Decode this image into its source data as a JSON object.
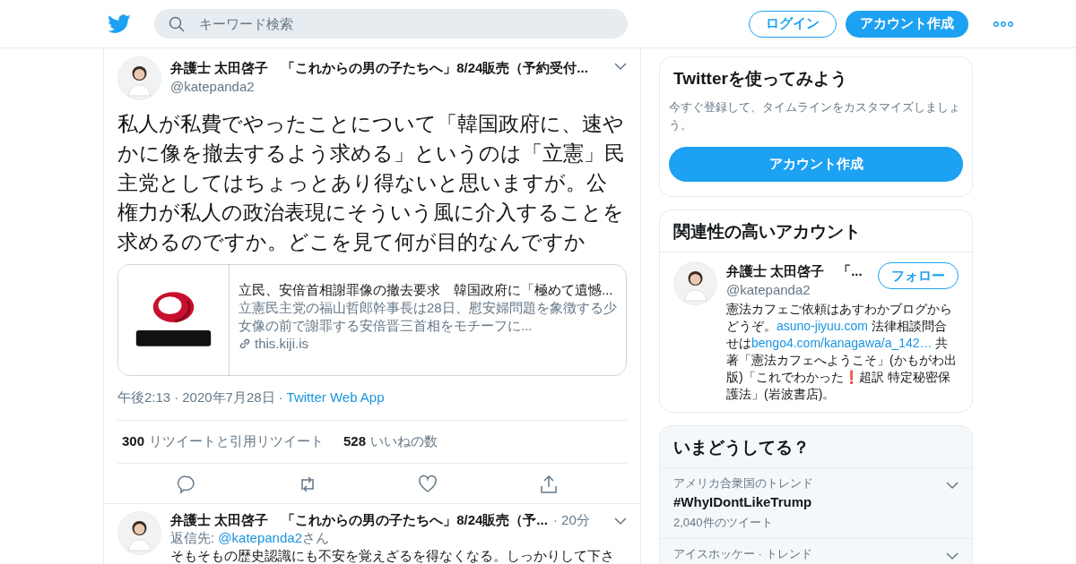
{
  "header": {
    "search": {
      "placeholder": "キーワード検索"
    },
    "login": "ログイン",
    "signup": "アカウント作成"
  },
  "tweet": {
    "name": "弁護士 太田啓子　「これからの男の子たちへ」8/24販売（予約受付...",
    "handle": "@katepanda2",
    "text": "私人が私費でやったことについて「韓国政府に、速やかに像を撤去するよう求める」というのは「立憲」民主党としてはちょっとあり得ないと思いますが。公権力が私人の政治表現にそういう風に介入することを求めるのですか。どこを見て何が目的なんですか",
    "card": {
      "title": "立民、安倍首相謝罪像の撤去要求　韓国政府に「極めて遺憾...",
      "description": "立憲民主党の福山哲郎幹事長は28日、慰安婦問題を象徴する少女像の前で謝罪する安倍晋三首相をモチーフに...",
      "domain": "this.kiji.is"
    },
    "time": "午後2:13",
    "separator": "·",
    "date": "2020年7月28日",
    "separator_2": "·",
    "source": "Twitter Web App",
    "stats": [
      {
        "count": "300",
        "label": "リツイートと引用リツイート"
      },
      {
        "count": "528",
        "label": "いいねの数"
      }
    ]
  },
  "reply": {
    "name": "弁護士 太田啓子　「これからの男の子たちへ」8/24販売（予...",
    "separator": "·",
    "time": "20分",
    "reply_to_label": "返信先: ",
    "reply_to": "@katepanda2",
    "reply_to_suffix": "さん",
    "text": "そもそもの歴史認識にも不安を覚えざるを得なくなる。しっかりして下さ"
  },
  "signup_card": {
    "title": "Twitterを使ってみよう",
    "text": "今すぐ登録して、タイムラインをカスタマイズしましょう。",
    "button": "アカウント作成"
  },
  "related": {
    "title": "関連性の高いアカウント",
    "account": {
      "name": "弁護士 太田啓子　「...",
      "handle": "@katepanda2",
      "follow": "フォロー",
      "bio": [
        {
          "kind": "text",
          "text": "憲法カフェご依頼はあすわかブログからどうぞ。"
        },
        {
          "kind": "link",
          "text": "asuno-jiyuu.com"
        },
        {
          "kind": "text",
          "text": " 法律相談問合せは"
        },
        {
          "kind": "link",
          "text": "bengo4.com/kanagawa/a_142…"
        },
        {
          "kind": "text",
          "text": " 共著「憲法カフェへようこそ」(かもがわ出版)「これでわかった❗超訳 特定秘密保護法」(岩波書店)。"
        }
      ]
    }
  },
  "trends": {
    "title": "いまどうしてる？",
    "items": [
      {
        "context": "アメリカ合衆国のトレンド",
        "topic": "#WhyIDontLikeTrump",
        "count": "2,040件のツイート"
      },
      {
        "context": "アイスホッケー · トレンド"
      }
    ]
  }
}
